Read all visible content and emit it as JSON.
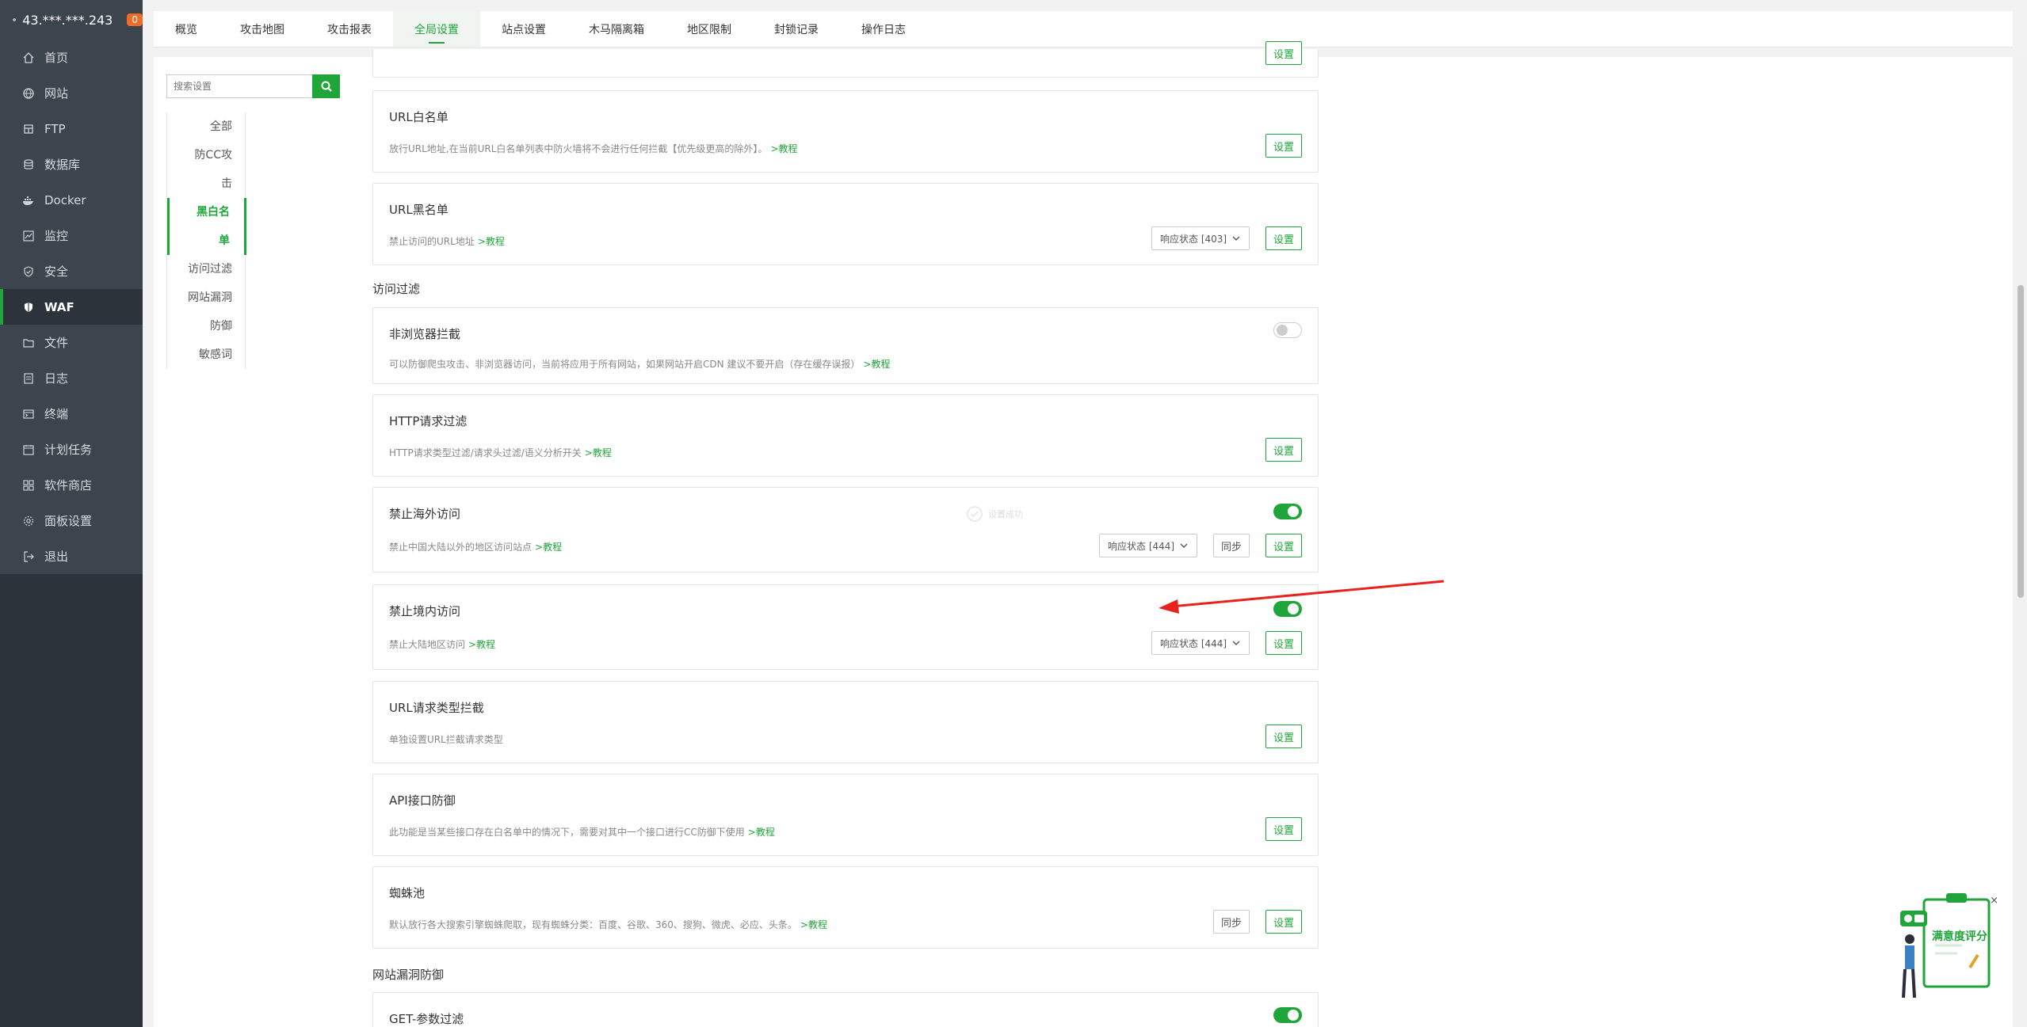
{
  "server": {
    "ip": "43.***.***.243",
    "badge": "0"
  },
  "sidebar": {
    "items": [
      {
        "label": "首页",
        "icon": "home-icon"
      },
      {
        "label": "网站",
        "icon": "globe-icon"
      },
      {
        "label": "FTP",
        "icon": "ftp-icon"
      },
      {
        "label": "数据库",
        "icon": "database-icon"
      },
      {
        "label": "Docker",
        "icon": "docker-icon"
      },
      {
        "label": "监控",
        "icon": "monitor-icon"
      },
      {
        "label": "安全",
        "icon": "shield-icon"
      },
      {
        "label": "WAF",
        "icon": "waf-icon",
        "active": true
      },
      {
        "label": "文件",
        "icon": "folder-icon"
      },
      {
        "label": "日志",
        "icon": "log-icon"
      },
      {
        "label": "终端",
        "icon": "terminal-icon"
      },
      {
        "label": "计划任务",
        "icon": "clock-icon"
      },
      {
        "label": "软件商店",
        "icon": "apps-icon"
      },
      {
        "label": "面板设置",
        "icon": "gear-icon"
      },
      {
        "label": "退出",
        "icon": "logout-icon"
      }
    ]
  },
  "tabs": [
    {
      "label": "概览"
    },
    {
      "label": "攻击地图"
    },
    {
      "label": "攻击报表"
    },
    {
      "label": "全局设置",
      "active": true
    },
    {
      "label": "站点设置"
    },
    {
      "label": "木马隔离箱"
    },
    {
      "label": "地区限制"
    },
    {
      "label": "封锁记录"
    },
    {
      "label": "操作日志"
    }
  ],
  "search": {
    "placeholder": "搜索设置"
  },
  "categories": [
    {
      "label": "全部"
    },
    {
      "label": "防CC攻"
    },
    {
      "label": "击"
    },
    {
      "label": "黑白名",
      "active": true
    },
    {
      "label": "单",
      "active": true
    },
    {
      "label": "访问过滤"
    },
    {
      "label": "网站漏洞"
    },
    {
      "label": "防御"
    },
    {
      "label": "敏感词"
    }
  ],
  "common": {
    "set": "设置",
    "sync": "同步",
    "tutorial": ">教程"
  },
  "sections": {
    "access_filter": "访问过滤",
    "vuln_defense": "网站漏洞防御"
  },
  "cards": {
    "url_white": {
      "title": "URL白名单",
      "desc": "放行URL地址,在当前URL白名单列表中防火墙将不会进行任何拦截【优先级更高的除外】。"
    },
    "url_black": {
      "title": "URL黑名单",
      "desc": "禁止访问的URL地址",
      "select": "响应状态 [403]"
    },
    "non_browser": {
      "title": "非浏览器拦截",
      "desc": "可以防御爬虫攻击、非浏览器访问，当前将应用于所有网站，如果网站开启CDN 建议不要开启（存在缓存误报）",
      "enabled": false
    },
    "http_filter": {
      "title": "HTTP请求过滤",
      "desc": "HTTP请求类型过滤/请求头过滤/语义分析开关"
    },
    "block_overseas": {
      "title": "禁止海外访问",
      "desc": "禁止中国大陆以外的地区访问站点",
      "select": "响应状态 [444]",
      "enabled": true,
      "ghost": "设置成功"
    },
    "block_domestic": {
      "title": "禁止境内访问",
      "desc": "禁止大陆地区访问",
      "select": "响应状态 [444]",
      "enabled": true
    },
    "url_type": {
      "title": "URL请求类型拦截",
      "desc": "单独设置URL拦截请求类型"
    },
    "api_defense": {
      "title": "API接口防御",
      "desc": "此功能是当某些接口存在白名单中的情况下，需要对其中一个接口进行CC防御下使用"
    },
    "spider_pool": {
      "title": "蜘蛛池",
      "desc": "默认放行各大搜索引擎蜘蛛爬取，现有蜘蛛分类：百度、谷歌、360、搜狗、微虎、必应、头条。"
    },
    "get_filter": {
      "title": "GET-参数过滤",
      "enabled": true
    }
  },
  "widget": {
    "label": "满意度评分"
  },
  "colors": {
    "accent": "#20a53a",
    "sidebar": "#3c444d",
    "arrow": "#e8231f"
  }
}
